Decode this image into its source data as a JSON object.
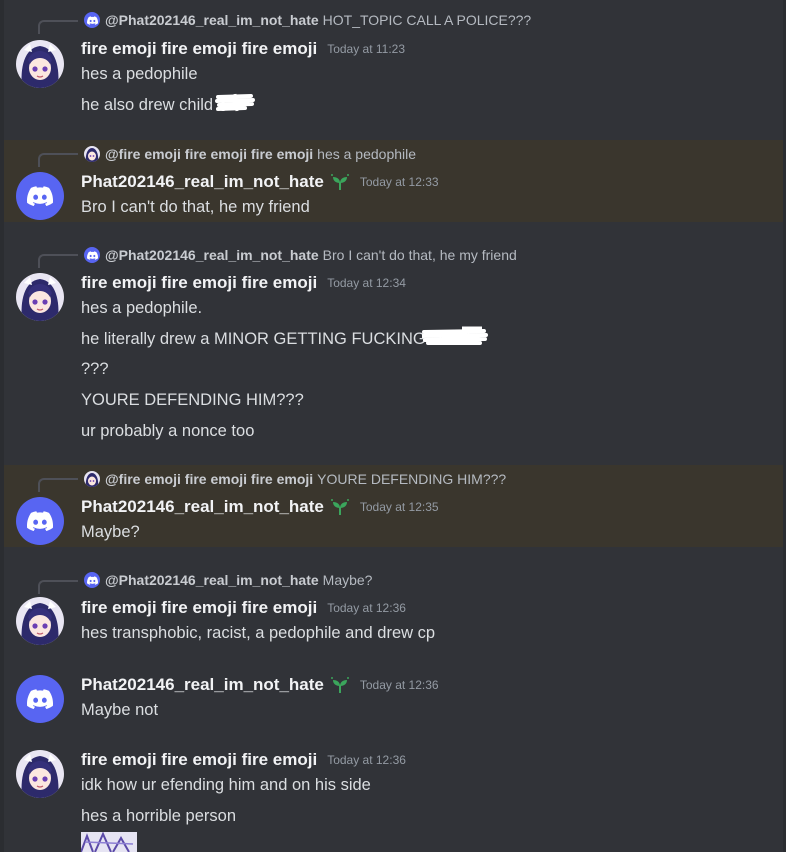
{
  "messages": [
    {
      "reply": {
        "name": "@Phat202146_real_im_not_hate",
        "text": "HOT_TOPIC CALL A POLICE???"
      },
      "author": "fire emoji fire emoji fire emoji",
      "time": "Today at 11:23",
      "lines": [
        "hes a pedophile",
        "he also drew child"
      ]
    },
    {
      "reply": {
        "name": "@fire emoji fire emoji fire emoji",
        "text": "hes a pedophile"
      },
      "author": "Phat202146_real_im_not_hate",
      "time": "Today at 12:33",
      "lines": [
        "Bro I can't do that, he my friend"
      ]
    },
    {
      "reply": {
        "name": "@Phat202146_real_im_not_hate",
        "text": "Bro I can't do that, he my friend"
      },
      "author": "fire emoji fire emoji fire emoji",
      "time": "Today at 12:34",
      "lines": [
        "hes a pedophile.",
        "he literally drew a MINOR GETTING FUCKING",
        "???",
        "YOURE DEFENDING HIM???",
        "ur probably a nonce too"
      ]
    },
    {
      "reply": {
        "name": "@fire emoji fire emoji fire emoji",
        "text": "YOURE DEFENDING HIM???"
      },
      "author": "Phat202146_real_im_not_hate",
      "time": "Today at 12:35",
      "lines": [
        "Maybe?"
      ]
    },
    {
      "reply": {
        "name": "@Phat202146_real_im_not_hate",
        "text": "Maybe?"
      },
      "author": "fire emoji fire emoji fire emoji",
      "time": "Today at 12:36",
      "lines": [
        "hes transphobic, racist, a pedophile and drew cp"
      ]
    },
    {
      "author": "Phat202146_real_im_not_hate",
      "time": "Today at 12:36",
      "lines": [
        "Maybe not"
      ]
    },
    {
      "author": "fire emoji fire emoji fire emoji",
      "time": "Today at 12:36",
      "lines": [
        "idk how ur efending him and on his side",
        "hes a horrible person"
      ]
    }
  ],
  "colors": {
    "background": "#313338",
    "highlight": "#3a362d",
    "discord_blurple": "#5865f2",
    "username": "#f2f3f5",
    "timestamp": "#949ba4",
    "sprout_badge": "#3ba55c"
  },
  "icons": {
    "discord_avatar": "discord-logo-icon",
    "anime_avatar": "anime-girl-avatar",
    "badge": "sprout-badge-icon"
  }
}
